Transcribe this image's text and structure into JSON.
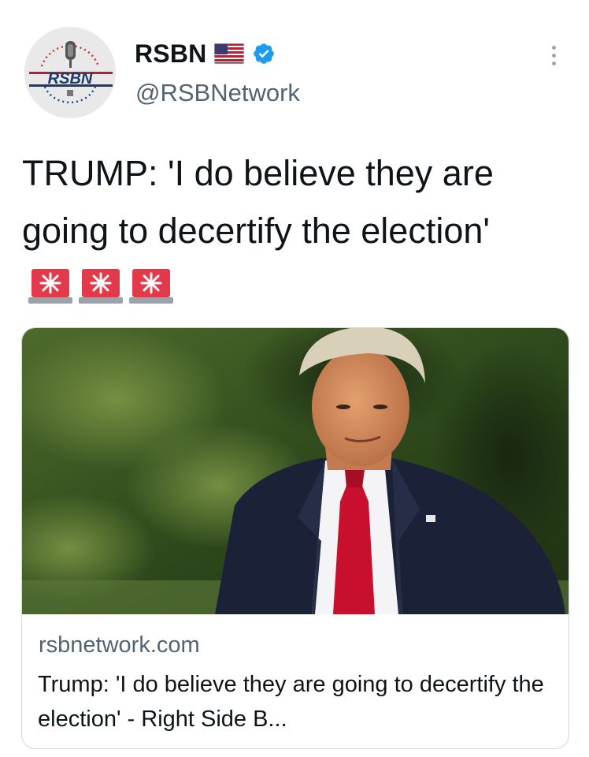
{
  "author": {
    "display_name": "RSBN",
    "handle": "@RSBNetwork",
    "avatar_text": "RSBN",
    "flag_icon": "us-flag-icon",
    "verified_icon": "verified-badge-icon",
    "verified_color": "#1d9bf0"
  },
  "menu": {
    "icon": "more-vertical-icon"
  },
  "tweet": {
    "text": "TRUMP: 'I do believe they are going to decertify the election'",
    "emoji": [
      "police-siren-icon",
      "police-siren-icon",
      "police-siren-icon"
    ]
  },
  "card": {
    "domain": "rsbnetwork.com",
    "title": "Trump: 'I do believe they are going to decertify the election' - Right Side B..."
  },
  "colors": {
    "text_primary": "#0f1419",
    "text_secondary": "#536471",
    "card_border": "#cfd9de",
    "siren_red": "#e23a4b"
  }
}
